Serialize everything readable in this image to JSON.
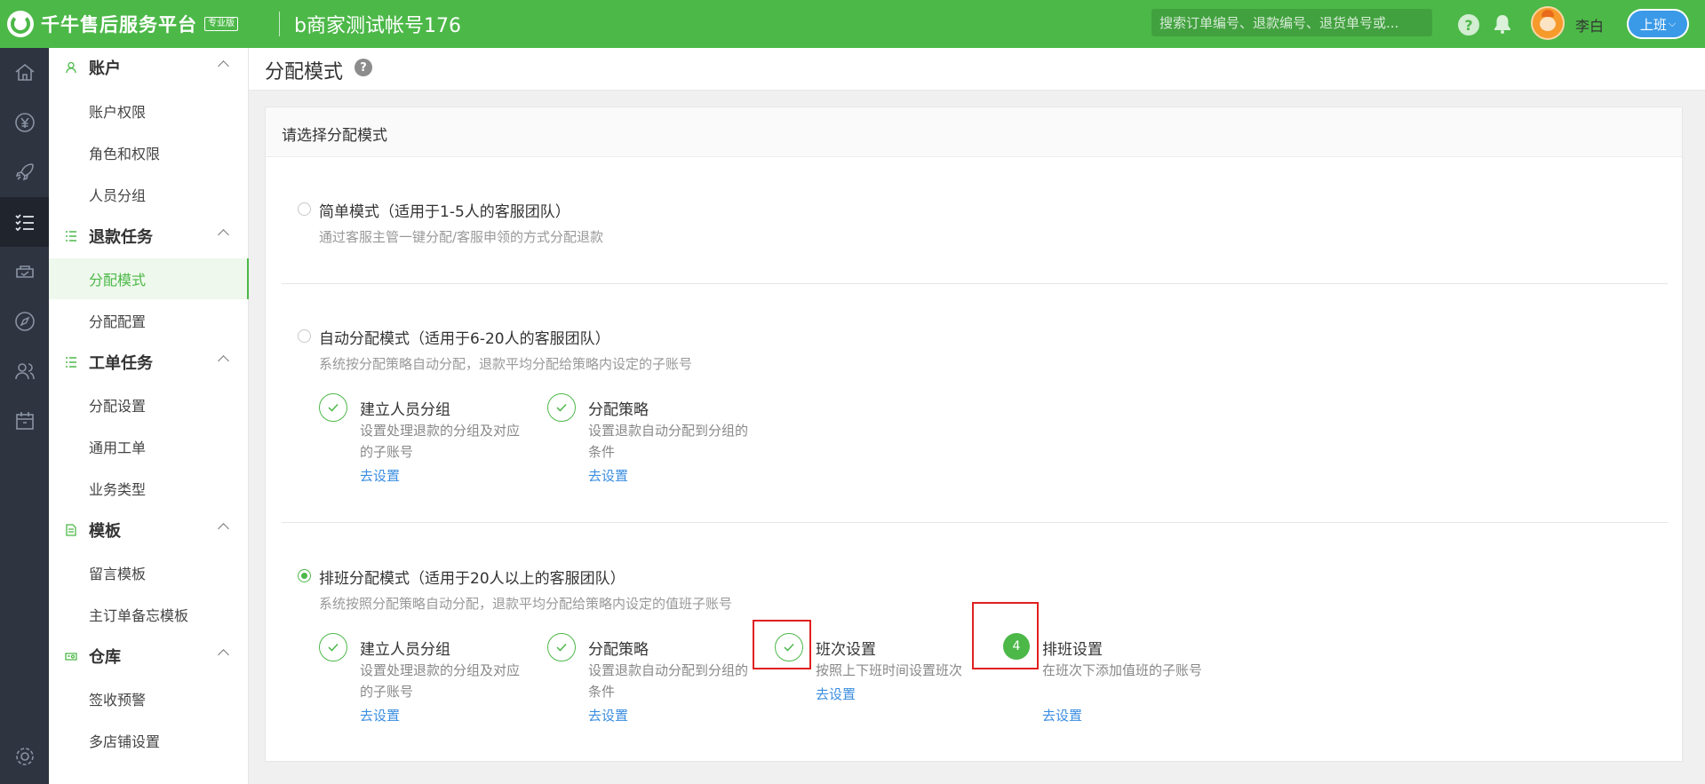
{
  "topbar": {
    "brand": "千牛售后服务平台",
    "edition_badge": "专业版",
    "account_title": "b商家测试帐号176",
    "search_placeholder": "搜索订单编号、退款编号、退货单号或...",
    "help_glyph": "?",
    "username": "李白",
    "onduty_label": "上班"
  },
  "iconbar": {
    "items": [
      "home-icon",
      "yuan-icon",
      "rocket-icon",
      "task-list-icon",
      "service-icon",
      "compass-icon",
      "users-icon",
      "calendar-icon",
      "settings-icon"
    ],
    "active_index": 3
  },
  "submenu": {
    "groups": [
      {
        "label": "账户",
        "icon": "user-icon",
        "items": [
          "账户权限",
          "角色和权限",
          "人员分组"
        ]
      },
      {
        "label": "退款任务",
        "icon": "list-icon",
        "items": [
          "分配模式",
          "分配配置"
        ]
      },
      {
        "label": "工单任务",
        "icon": "list-icon",
        "items": [
          "分配设置",
          "通用工单",
          "业务类型"
        ]
      },
      {
        "label": "模板",
        "icon": "document-icon",
        "items": [
          "留言模板",
          "主订单备忘模板"
        ]
      },
      {
        "label": "仓库",
        "icon": "warehouse-icon",
        "items": [
          "签收预警",
          "多店铺设置"
        ]
      }
    ],
    "active_item": "分配模式"
  },
  "page": {
    "title": "分配模式",
    "help_glyph": "?"
  },
  "card": {
    "title": "请选择分配模式",
    "modes": [
      {
        "title": "简单模式（适用于1-5人的客服团队）",
        "desc": "通过客服主管一键分配/客服申领的方式分配退款",
        "checked": false,
        "steps": []
      },
      {
        "title": "自动分配模式（适用于6-20人的客服团队）",
        "desc": "系统按分配策略自动分配，退款平均分配给策略内设定的子账号",
        "checked": false,
        "steps": [
          {
            "title": "建立人员分组",
            "desc": "设置处理退款的分组及对应的子账号",
            "link": "去设置",
            "done": true
          },
          {
            "title": "分配策略",
            "desc": "设置退款自动分配到分组的条件",
            "link": "去设置",
            "done": true
          }
        ]
      },
      {
        "title": "排班分配模式（适用于20人以上的客服团队）",
        "desc": "系统按照分配策略自动分配，退款平均分配给策略内设定的值班子账号",
        "checked": true,
        "steps": [
          {
            "title": "建立人员分组",
            "desc": "设置处理退款的分组及对应的子账号",
            "link": "去设置",
            "done": true
          },
          {
            "title": "分配策略",
            "desc": "设置退款自动分配到分组的条件",
            "link": "去设置",
            "done": true
          },
          {
            "title": "班次设置",
            "desc": "按照上下班时间设置班次",
            "link": "去设置",
            "done": true
          },
          {
            "title": "排班设置",
            "desc": "在班次下添加值班的子账号",
            "link": "去设置",
            "done": false,
            "number": "4"
          }
        ]
      }
    ]
  },
  "colors": {
    "brand_green": "#4cb848",
    "sidebar_dark": "#2e3440",
    "link_blue": "#3b8ee0",
    "highlight_red": "#e02020",
    "onduty_blue": "#3b9ae8"
  }
}
